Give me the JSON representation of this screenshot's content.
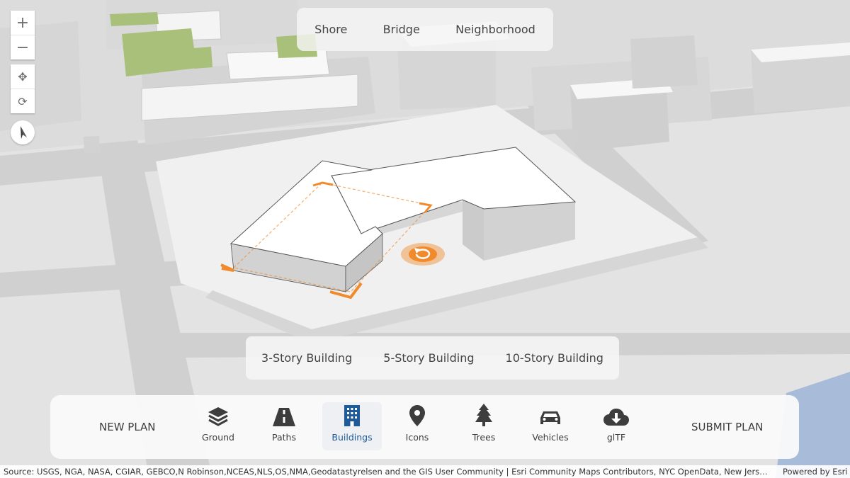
{
  "map": {
    "zoom_in_symbol": "+",
    "zoom_out_symbol": "−",
    "pan_symbol": "✥",
    "rotate_symbol": "⟳",
    "icons": [
      "zoom-in-icon",
      "zoom-out-icon",
      "pan-icon",
      "rotate-icon",
      "compass-icon"
    ]
  },
  "bookmarks": [
    "Shore",
    "Bridge",
    "Neighborhood"
  ],
  "building_options": [
    "3-Story Building",
    "5-Story Building",
    "10-Story Building"
  ],
  "toolbar": {
    "new_plan": "NEW PLAN",
    "submit_plan": "SUBMIT PLAN",
    "tools": [
      {
        "label": "Ground",
        "icon": "layers-icon"
      },
      {
        "label": "Paths",
        "icon": "road-icon"
      },
      {
        "label": "Buildings",
        "icon": "building-icon",
        "active": true
      },
      {
        "label": "Icons",
        "icon": "map-pin-icon"
      },
      {
        "label": "Trees",
        "icon": "tree-icon"
      },
      {
        "label": "Vehicles",
        "icon": "car-icon"
      },
      {
        "label": "glTF",
        "icon": "cloud-download-icon"
      }
    ]
  },
  "attribution": {
    "source": "Source: USGS, NGA, NASA, CGIAR, GEBCO,N Robinson,NCEAS,NLS,OS,NMA,Geodatastyrelsen and the GIS User Community | Esri Community Maps Contributors, NYC OpenData, New Jers…",
    "powered_by": "Powered by Esri"
  },
  "colors": {
    "selection": "#f08a2b",
    "active_tool": "#1f5a99",
    "park": "#a9c07a",
    "water": "#a8bcd9"
  }
}
